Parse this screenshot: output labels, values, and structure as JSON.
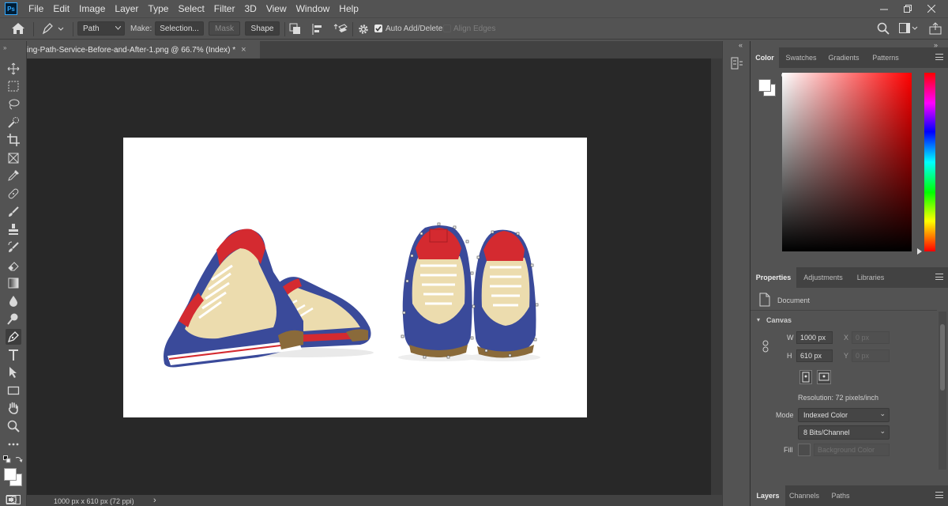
{
  "menubar": {
    "logo": "Ps",
    "items": [
      "File",
      "Edit",
      "Image",
      "Layer",
      "Type",
      "Select",
      "Filter",
      "3D",
      "View",
      "Window",
      "Help"
    ]
  },
  "options": {
    "mode_value": "Path",
    "make_label": "Make:",
    "selection_label": "Selection...",
    "mask_label": "Mask",
    "shape_label": "Shape",
    "auto_add_delete_label": "Auto Add/Delete",
    "auto_add_delete_checked": true,
    "align_edges_label": "Align Edges",
    "align_edges_checked": false
  },
  "document_tab": {
    "title": "ing-Path-Service-Before-and-After-1.png @ 66.7% (Index) *",
    "close": "×"
  },
  "statusbar": {
    "dimensions": "1000 px x 610 px (72 ppi)",
    "arrow": "›"
  },
  "color_panel": {
    "tabs": [
      "Color",
      "Swatches",
      "Gradients",
      "Patterns"
    ],
    "active_tab": "Color",
    "hue_color": "#ff0000",
    "foreground": "#ffffff",
    "background": "#ffffff"
  },
  "properties_panel": {
    "tabs": [
      "Properties",
      "Adjustments",
      "Libraries"
    ],
    "active_tab": "Properties",
    "document_label": "Document",
    "canvas_section": "Canvas",
    "w_label": "W",
    "w_value": "1000 px",
    "h_label": "H",
    "h_value": "610 px",
    "x_label": "X",
    "x_value": "0 px",
    "y_label": "Y",
    "y_value": "0 px",
    "resolution": "Resolution: 72 pixels/inch",
    "mode_label": "Mode",
    "mode_value": "Indexed Color",
    "bits_value": "8 Bits/Channel",
    "fill_label": "Fill",
    "fill_value": "Background Color"
  },
  "layers_panel": {
    "tabs": [
      "Layers",
      "Channels",
      "Paths"
    ],
    "active_tab": "Layers"
  },
  "colors": {
    "chrome": "#535353",
    "canvas_bg": "#282828",
    "shoe_blue": "#3a4a9a",
    "shoe_red": "#d42a30",
    "shoe_cream": "#ecdcae",
    "accent": "#31a8ff"
  }
}
